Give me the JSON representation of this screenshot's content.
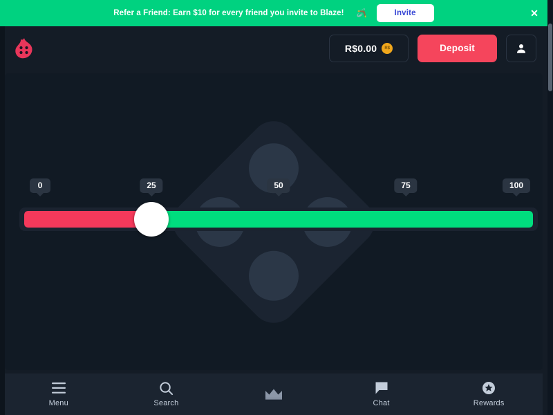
{
  "banner": {
    "text": "Refer a Friend: Earn $10 for every friend you invite to Blaze!",
    "emoji": "🪃",
    "invite_label": "Invite",
    "close_icon": "close-icon",
    "bg_color": "#00d280",
    "invite_text_color": "#3b4ad6"
  },
  "header": {
    "logo_name": "blaze-flame-dice-logo",
    "balance": "R$0.00",
    "currency_badge": "R$",
    "deposit_label": "Deposit",
    "deposit_color": "#f5455c",
    "account_icon": "user-avatar-icon"
  },
  "slider": {
    "ticks": [
      {
        "label": "0",
        "percent": 0
      },
      {
        "label": "25",
        "percent": 25
      },
      {
        "label": "50",
        "percent": 50
      },
      {
        "label": "75",
        "percent": 75
      },
      {
        "label": "100",
        "percent": 100
      }
    ],
    "value": 26,
    "min": 0,
    "max": 100,
    "lose_color": "#f5395b",
    "win_color": "#00dd7e",
    "handle_name": "slider-handle"
  },
  "background": {
    "watermark": "dice-four-watermark"
  },
  "bottom_nav": [
    {
      "label": "Menu",
      "icon": "hamburger-menu-icon"
    },
    {
      "label": "Search",
      "icon": "search-icon"
    },
    {
      "label": "",
      "icon": "crown-icon"
    },
    {
      "label": "Chat",
      "icon": "chat-bubble-icon"
    },
    {
      "label": "Rewards",
      "icon": "star-badge-icon"
    }
  ]
}
